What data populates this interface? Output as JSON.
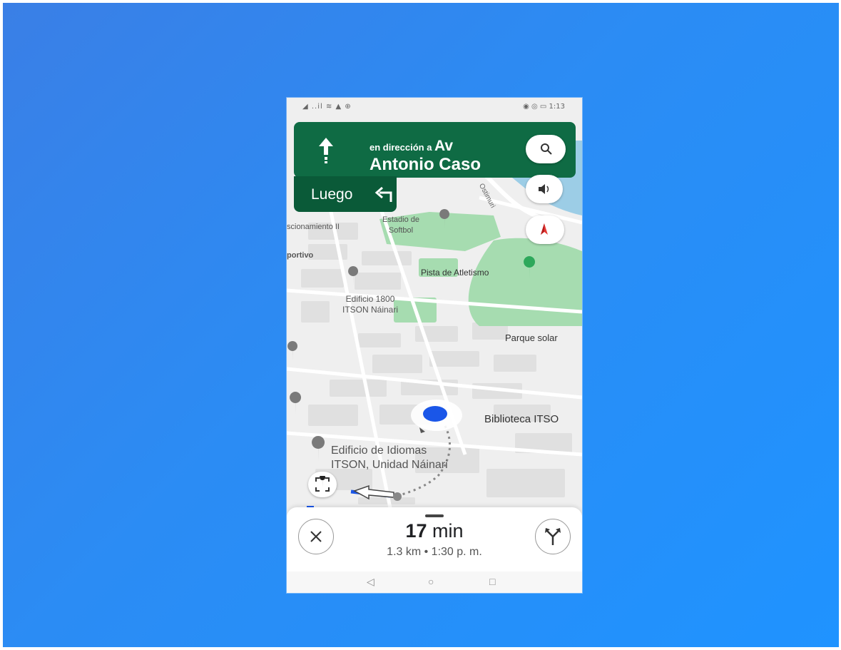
{
  "status_bar": {
    "left": "◢ ..il ≋ ▲ ⊕",
    "right": "◉ ◎ ▭ 1:13"
  },
  "navigation": {
    "direction_prefix": "en dirección a",
    "street_line1": "Av",
    "street_line2": "Antonio Caso",
    "then_label": "Luego",
    "icons": {
      "direction": "straight-arrow-icon",
      "then": "turn-left-icon"
    }
  },
  "map_labels": {
    "softbol": [
      "Estadio de",
      "Softbol"
    ],
    "estacionamiento": "scionamiento II",
    "deportivo": "portivo",
    "atletismo": "Pista de Atletismo",
    "edificio1800": [
      "Edificio 1800",
      "ITSON Náinari"
    ],
    "parque": "Parque solar",
    "biblioteca": "Biblioteca ITSO",
    "idiomas": [
      "Edificio de Idiomas",
      "ITSON, Unidad Náinari"
    ],
    "street": "Ostimuri"
  },
  "bottom_sheet": {
    "eta_value": "17",
    "eta_unit": "min",
    "details": "1.3 km • 1:30 p. m."
  },
  "buttons": {
    "search": "search-icon",
    "sound": "volume-icon",
    "compass": "compass-icon",
    "recenter": "recenter-icon",
    "close": "close-icon",
    "routes": "alternate-routes-icon"
  },
  "system_nav": {
    "back": "◁",
    "home": "○",
    "recents": "□"
  },
  "colors": {
    "background": "#2b8cf4",
    "nav_card": "#0f6b44",
    "then_card": "#0a5a38",
    "route_blue": "#1a56e8",
    "park_green": "#9ad8a4"
  }
}
